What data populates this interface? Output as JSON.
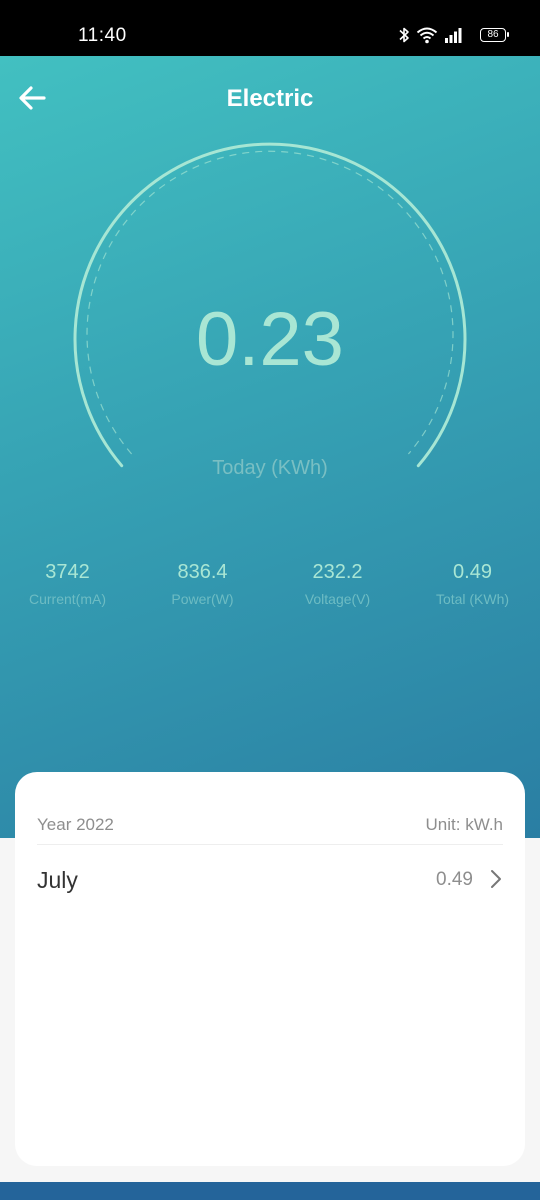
{
  "status_bar": {
    "time": "11:40",
    "battery": "86",
    "icons": [
      "bluetooth-icon",
      "wifi-icon",
      "signal-icon",
      "battery-icon"
    ]
  },
  "header": {
    "title": "Electric",
    "back_icon": "arrow-left-icon"
  },
  "gauge": {
    "value": "0.23",
    "label": "Today (KWh)"
  },
  "metrics": [
    {
      "value": "3742",
      "label": "Current(mA)"
    },
    {
      "value": "836.4",
      "label": "Power(W)"
    },
    {
      "value": "232.2",
      "label": "Voltage(V)"
    },
    {
      "value": "0.49",
      "label": "Total (KWh)"
    }
  ],
  "history": {
    "year": "Year 2022",
    "unit": "Unit: kW.h",
    "months": [
      {
        "name": "July",
        "value": "0.49"
      }
    ]
  },
  "colors": {
    "gradient_start": "#42c0c1",
    "gradient_end": "#2a7ea3",
    "accent_value": "#a9e6d4",
    "label_muted": "#79bfc3"
  }
}
